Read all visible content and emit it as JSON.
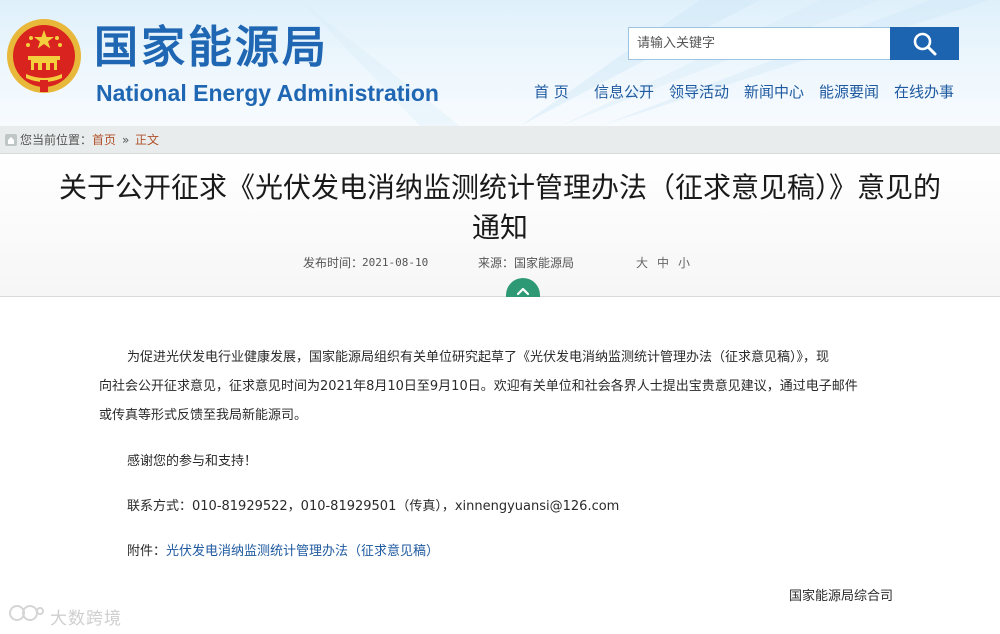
{
  "header": {
    "logo_cn": "国家能源局",
    "logo_en": "National Energy Administration",
    "search": {
      "placeholder": "请输入关键字"
    },
    "nav": [
      "首 页",
      "信息公开",
      "领导活动",
      "新闻中心",
      "能源要闻",
      "在线办事"
    ]
  },
  "breadcrumb": {
    "label": "您当前位置：",
    "items": [
      "首页",
      "正文"
    ],
    "separator": "»"
  },
  "article": {
    "title_line1": "关于公开征求《光伏发电消纳监测统计管理办法（征求意见稿）》意见的",
    "title_line2": "通知",
    "date_label": "发布时间：",
    "date": "2021-08-10",
    "source_label": "来源：",
    "source": "国家能源局",
    "font_sizes": [
      "大",
      "中",
      "小"
    ],
    "paragraph1_line1": "为促进光伏发电行业健康发展，国家能源局组织有关单位研究起草了《光伏发电消纳监测统计管理办法（征求意见稿）》，现",
    "paragraph1_line2": "向社会公开征求意见，征求意见时间为2021年8月10日至9月10日。欢迎有关单位和社会各界人士提出宝贵意见建议，通过电子邮件",
    "paragraph1_line3": "或传真等形式反馈至我局新能源司。",
    "thanks": "感谢您的参与和支持！",
    "contact": "联系方式：010-81929522，010-81929501（传真），xinnengyuansi@126.com",
    "attachment_label": "附件：",
    "attachment_link": "光伏发电消纳监测统计管理办法（征求意见稿）",
    "signature": "国家能源局综合司"
  },
  "watermark": "大数跨境",
  "colors": {
    "brand_blue": "#1f66b3",
    "search_button": "#1c63b0",
    "breadcrumb_link": "#b0522c",
    "fold_tab": "#2e9a75"
  }
}
